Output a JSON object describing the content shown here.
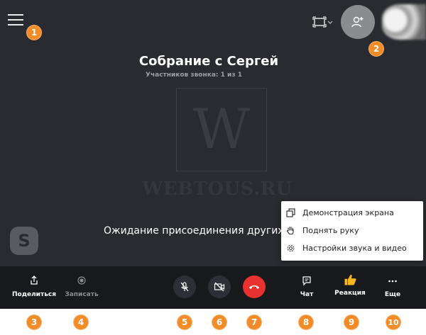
{
  "header": {
    "title": "Собрание с Сергей",
    "participants": "Участников звонка: 1 из 1"
  },
  "stage": {
    "waiting_text": "Ожидание присоединения других уч",
    "watermark_letter": "W",
    "watermark_text": "WEBTOUS.RU"
  },
  "popup": {
    "items": [
      {
        "label": "Демонстрация экрана",
        "icon": "screen-share-icon"
      },
      {
        "label": "Поднять руку",
        "icon": "raise-hand-icon"
      },
      {
        "label": "Настройки звука и видео",
        "icon": "settings-gear-icon"
      }
    ]
  },
  "toolbar": {
    "share_label": "Поделиться",
    "record_label": "Записать",
    "chat_label": "Чат",
    "reaction_label": "Реакция",
    "more_label": "Еще"
  },
  "badges": [
    "1",
    "2",
    "3",
    "4",
    "5",
    "6",
    "7",
    "8",
    "9",
    "10"
  ],
  "colors": {
    "stage_bg": "#2a2b30",
    "toolbar_bg": "#18191c",
    "badge": "#f28c28",
    "hangup": "#e8322f",
    "reaction": "#f6b61c"
  }
}
